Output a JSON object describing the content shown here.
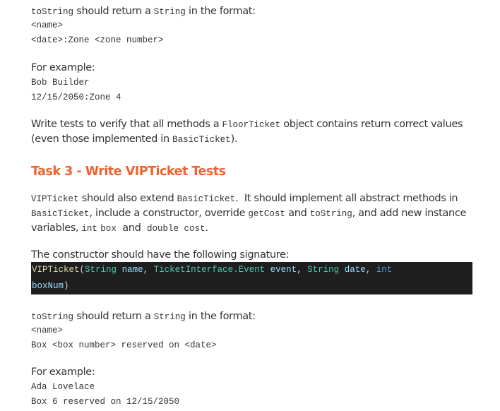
{
  "section1": {
    "tostring_intro": {
      "code1": "toString",
      "text1": " should return a ",
      "code2": "String",
      "text2": " in the format:"
    },
    "format_lines": [
      "<name>",
      "<date>:Zone <zone number>"
    ],
    "example_label": "For example:",
    "example_lines": [
      "Bob Builder",
      "12/15/2050:Zone 4"
    ],
    "tests_para": {
      "text1": "Write tests to verify that all methods a ",
      "code1": "FloorTicket",
      "text2": " object contains return correct values (even those implemented in ",
      "code2": "BasicTicket",
      "text3": ")."
    }
  },
  "task3": {
    "heading": "Task 3 - Write VIPTicket Tests",
    "heading_color": "#f0622e",
    "intro": {
      "code1": "VIPTicket",
      "text1": " should also extend ",
      "code2": "BasicTicket",
      "text2": ".  It should implement all abstract methods in ",
      "code3": "BasicTicket",
      "text3": ", include a constructor, override ",
      "code4": "getCost",
      "text4": " and ",
      "code5": "toString",
      "text5": ", and add new instance variables, ",
      "code6": "int",
      "text6": " ",
      "code7": "box",
      "text7": "  and  ",
      "code8": "double cost",
      "text8": "."
    },
    "constructor_label": "The constructor should have the following signature:",
    "constructor_code": {
      "fn": "VIPTicket",
      "open": "(",
      "t1": "String",
      "v1": "name",
      "t2": "TicketInterface.Event",
      "v2": "event",
      "t3": "String",
      "v3": "date",
      "t4": "int",
      "v4": "boxNum",
      "close": ")",
      "comma": ", "
    },
    "tostring_intro": {
      "code1": "toString",
      "text1": " should return a ",
      "code2": "String",
      "text2": " in the format:"
    },
    "format_lines": [
      "<name>",
      "Box <box number> reserved on <date>"
    ],
    "example_label": "For example:",
    "example_lines": [
      "Ada Lovelace",
      "Box 6 reserved on 12/15/2050"
    ]
  }
}
